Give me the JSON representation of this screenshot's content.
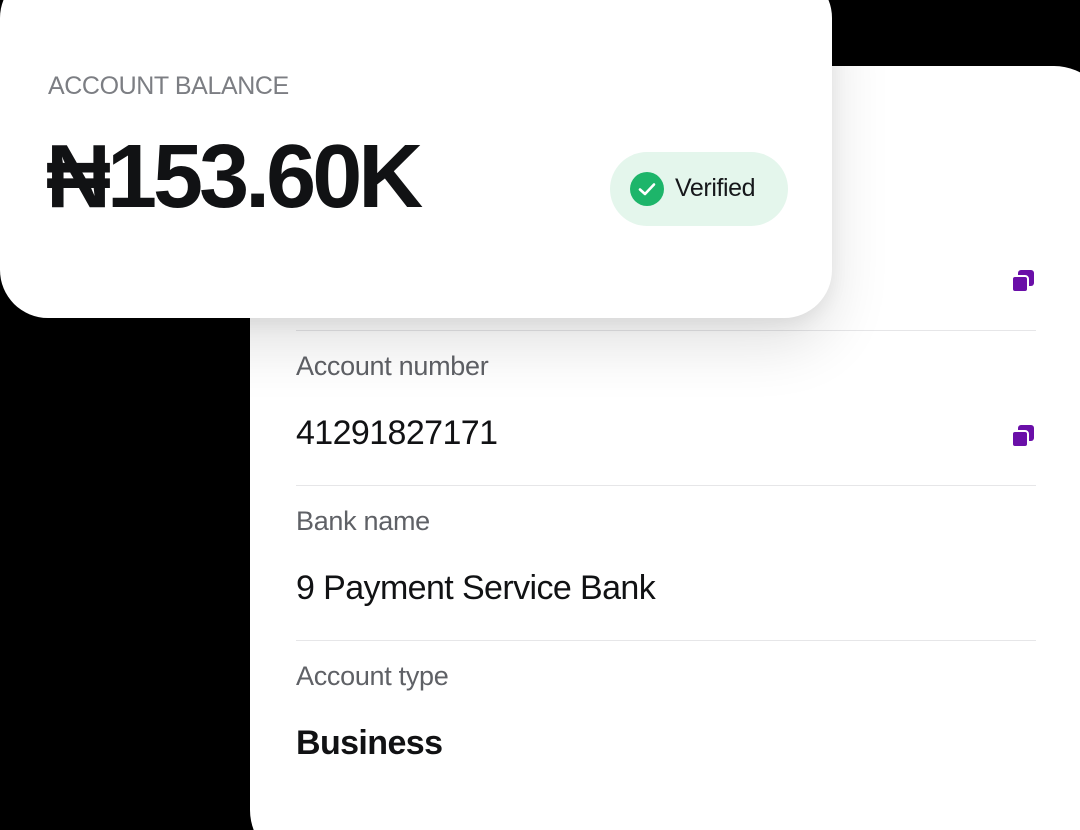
{
  "balance": {
    "label": "ACCOUNT BALANCE",
    "amount": "₦153.60K",
    "status": "Verified"
  },
  "details": [
    {
      "label": "Account number",
      "value": "41291827171",
      "copyable": true
    },
    {
      "label": "Bank name",
      "value": "9 Payment Service Bank",
      "copyable": false
    },
    {
      "label": "Account type",
      "value": "Business",
      "copyable": false
    }
  ],
  "colors": {
    "accent": "#6a0fa8",
    "verified_bg": "#e4f6ec",
    "verified_check": "#1db56a"
  },
  "icons": {
    "copy": "copy-icon",
    "check": "check-circle-icon"
  }
}
